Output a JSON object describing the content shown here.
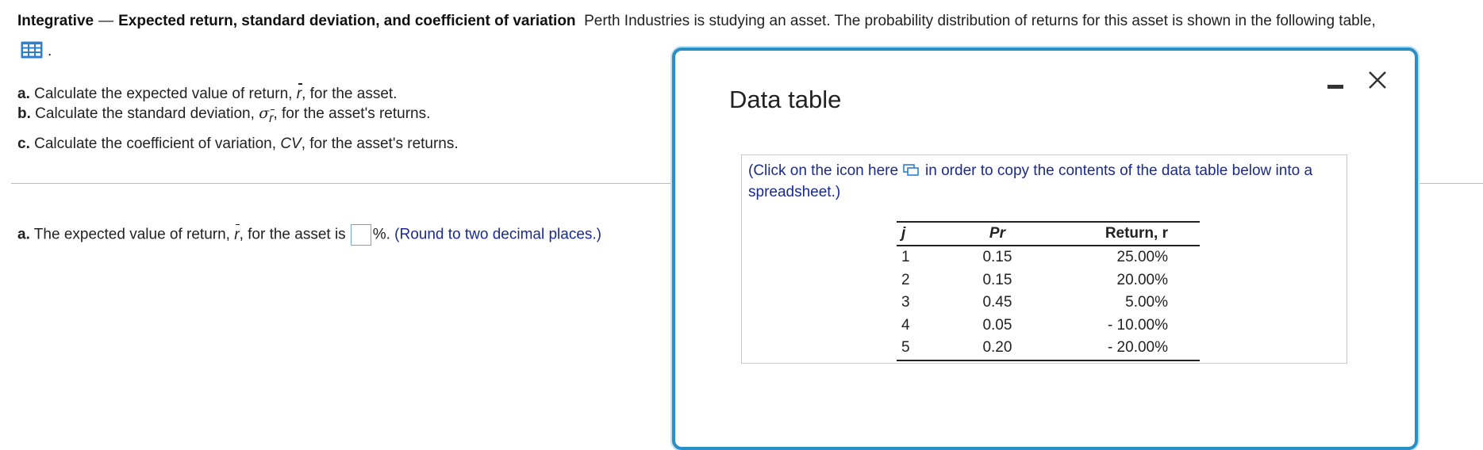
{
  "header": {
    "label": "Integrative",
    "dash": "—",
    "title": "Expected return, standard deviation, and coefficient of variation",
    "text": "Perth Industries is studying an asset.  The probability distribution of returns for this asset is shown in the following table,",
    "dot": "."
  },
  "questions": {
    "a": {
      "label": "a.",
      "pre": "Calculate the expected value of return,",
      "var": "r",
      "post": ", for the asset."
    },
    "b": {
      "label": "b.",
      "pre": "Calculate the standard deviation,",
      "var": "σ",
      "sub": "r",
      "post": ", for the asset's returns."
    },
    "c": {
      "label": "c.",
      "pre": "Calculate the coefficient of variation,",
      "var": "CV",
      "post": ", for the asset's returns."
    }
  },
  "answer": {
    "label": "a.",
    "pre": "The expected value of return,",
    "var": "r",
    "mid": ", for the asset is",
    "unit": "%.",
    "hint": "(Round to two decimal places.)",
    "value": ""
  },
  "modal": {
    "title": "Data table",
    "copy_pre": "(Click on the icon here",
    "copy_post": "in order to copy the contents of the data table below into a spreadsheet.)",
    "table": {
      "headers": [
        "j",
        "Pr",
        "Return, r"
      ],
      "rows": [
        [
          "1",
          "0.15",
          "25.00%"
        ],
        [
          "2",
          "0.15",
          "20.00%"
        ],
        [
          "3",
          "0.45",
          "5.00%"
        ],
        [
          "4",
          "0.05",
          "- 10.00%"
        ],
        [
          "5",
          "0.20",
          "- 20.00%"
        ]
      ]
    }
  },
  "colors": {
    "accent": "#2a8fc4",
    "hint": "#1a2b8c",
    "icon": "#2f7fd0"
  },
  "icons": [
    "table-icon",
    "copy-icon",
    "minimize-icon",
    "close-icon"
  ]
}
